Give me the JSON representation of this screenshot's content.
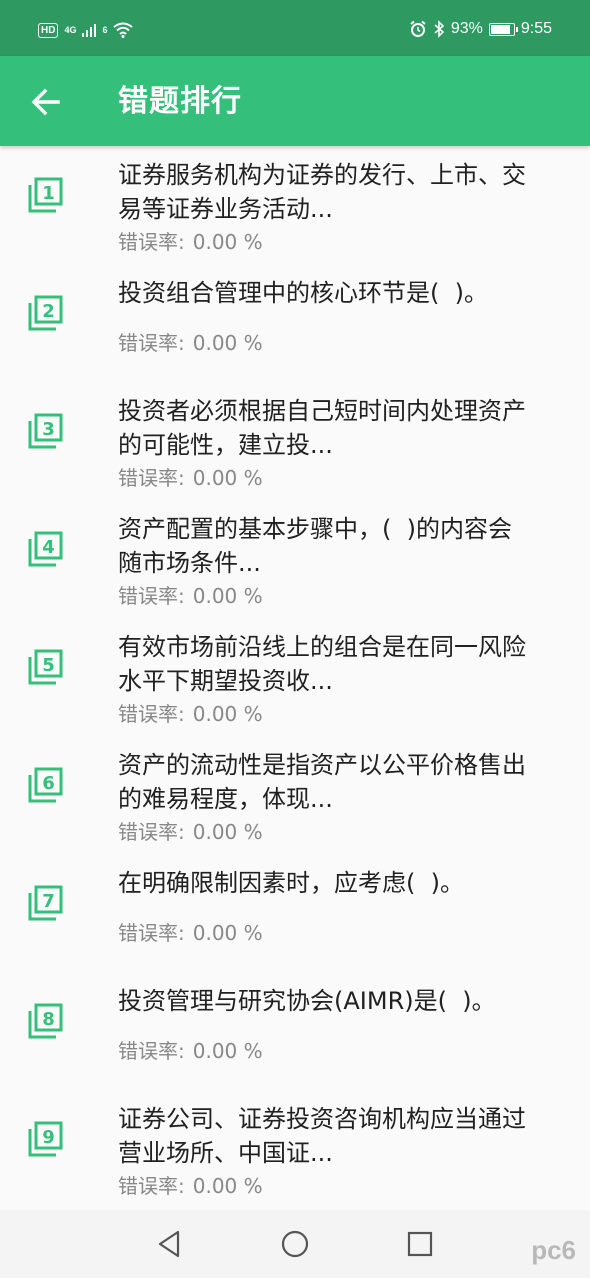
{
  "status_bar": {
    "hd": "HD",
    "signal_label": "4G",
    "wifi_label": "6",
    "battery": "93%",
    "battery_level": 0.93,
    "time": "9:55"
  },
  "app_bar": {
    "title": "错题排行",
    "back_icon": "arrow-left-icon"
  },
  "colors": {
    "status_bar": "#2e9a62",
    "app_bar": "#34c07b",
    "accent_icon": "#34c07b"
  },
  "items": [
    {
      "rank": "1",
      "title_line1": "证券服务机构为证券的发行、上市、交",
      "title_line2": "易等证券业务活动...",
      "error_label": "错误率:",
      "error_value": "0.00 %"
    },
    {
      "rank": "2",
      "title_line1": "投资组合管理中的核心环节是(  )。",
      "title_line2": "",
      "error_label": "错误率:",
      "error_value": "0.00 %"
    },
    {
      "rank": "3",
      "title_line1": "投资者必须根据自己短时间内处理资产",
      "title_line2": "的可能性，建立投...",
      "error_label": "错误率:",
      "error_value": "0.00 %"
    },
    {
      "rank": "4",
      "title_line1": "资产配置的基本步骤中，(  )的内容会",
      "title_line2": "随市场条件...",
      "error_label": "错误率:",
      "error_value": "0.00 %"
    },
    {
      "rank": "5",
      "title_line1": "有效市场前沿线上的组合是在同一风险",
      "title_line2": "水平下期望投资收...",
      "error_label": "错误率:",
      "error_value": "0.00 %"
    },
    {
      "rank": "6",
      "title_line1": "资产的流动性是指资产以公平价格售出",
      "title_line2": "的难易程度，体现...",
      "error_label": "错误率:",
      "error_value": "0.00 %"
    },
    {
      "rank": "7",
      "title_line1": "在明确限制因素时，应考虑(  )。",
      "title_line2": "",
      "error_label": "错误率:",
      "error_value": "0.00 %"
    },
    {
      "rank": "8",
      "title_line1": "投资管理与研究协会(AIMR)是(  )。",
      "title_line2": "",
      "error_label": "错误率:",
      "error_value": "0.00 %"
    },
    {
      "rank": "9",
      "title_line1": "证券公司、证券投资咨询机构应当通过",
      "title_line2": "营业场所、中国证...",
      "error_label": "错误率:",
      "error_value": "0.00 %"
    }
  ],
  "nav_bar": {
    "back_icon": "triangle-back-icon",
    "home_icon": "circle-home-icon",
    "recents_icon": "square-recents-icon"
  },
  "watermark": "pc6"
}
